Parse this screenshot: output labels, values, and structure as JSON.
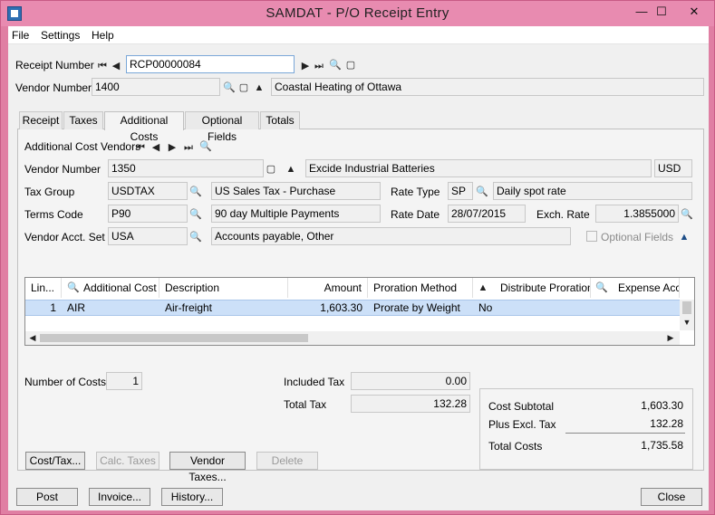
{
  "window": {
    "title": "SAMDAT - P/O Receipt Entry",
    "minimize": "—",
    "maximize": "☐",
    "close": "✕"
  },
  "menu": {
    "file": "File",
    "settings": "Settings",
    "help": "Help"
  },
  "header": {
    "receipt_label": "Receipt Number",
    "receipt_value": "RCP00000084",
    "vendor_label": "Vendor Number",
    "vendor_value": "1400",
    "vendor_name": "Coastal Heating of Ottawa"
  },
  "tabs": [
    "Receipt",
    "Taxes",
    "Additional Costs",
    "Optional Fields",
    "Totals"
  ],
  "costs": {
    "vendors_label": "Additional Cost Vendors",
    "vendor_label": "Vendor Number",
    "vendor_value": "1350",
    "vendor_name": "Excide Industrial Batteries",
    "currency": "USD",
    "tax_group_label": "Tax Group",
    "tax_group_value": "USDTAX",
    "tax_group_desc": "US Sales Tax - Purchase",
    "rate_type_label": "Rate Type",
    "rate_type_value": "SP",
    "rate_type_desc": "Daily spot rate",
    "terms_label": "Terms Code",
    "terms_value": "P90",
    "terms_desc": "90 day Multiple Payments",
    "rate_date_label": "Rate Date",
    "rate_date_value": "28/07/2015",
    "exch_rate_label": "Exch. Rate",
    "exch_rate_value": "1.3855000",
    "acct_set_label": "Vendor Acct. Set",
    "acct_set_value": "USA",
    "acct_set_desc": "Accounts payable, Other",
    "optional_fields_label": "Optional Fields"
  },
  "grid": {
    "headers": [
      "Lin...",
      "Additional Cost",
      "Description",
      "Amount",
      "Proration Method",
      "Distribute Proration",
      "Expense Acco"
    ],
    "rows": [
      {
        "line": "1",
        "cost": "AIR",
        "description": "Air-freight",
        "amount": "1,603.30",
        "method": "Prorate by Weight",
        "distribute": "No",
        "expense": ""
      }
    ]
  },
  "bottom": {
    "num_costs_label": "Number of Costs",
    "num_costs_value": "1",
    "included_tax_label": "Included Tax",
    "included_tax_value": "0.00",
    "total_tax_label": "Total Tax",
    "total_tax_value": "132.28",
    "cost_subtotal_label": "Cost Subtotal",
    "cost_subtotal_value": "1,603.30",
    "plus_excl_tax_label": "Plus Excl. Tax",
    "plus_excl_tax_value": "132.28",
    "total_costs_label": "Total Costs",
    "total_costs_value": "1,735.58"
  },
  "actions": {
    "cost_tax": "Cost/Tax...",
    "calc_taxes": "Calc. Taxes",
    "vendor_taxes": "Vendor Taxes...",
    "delete": "Delete",
    "post": "Post",
    "invoice": "Invoice...",
    "history": "History...",
    "close": "Close"
  }
}
